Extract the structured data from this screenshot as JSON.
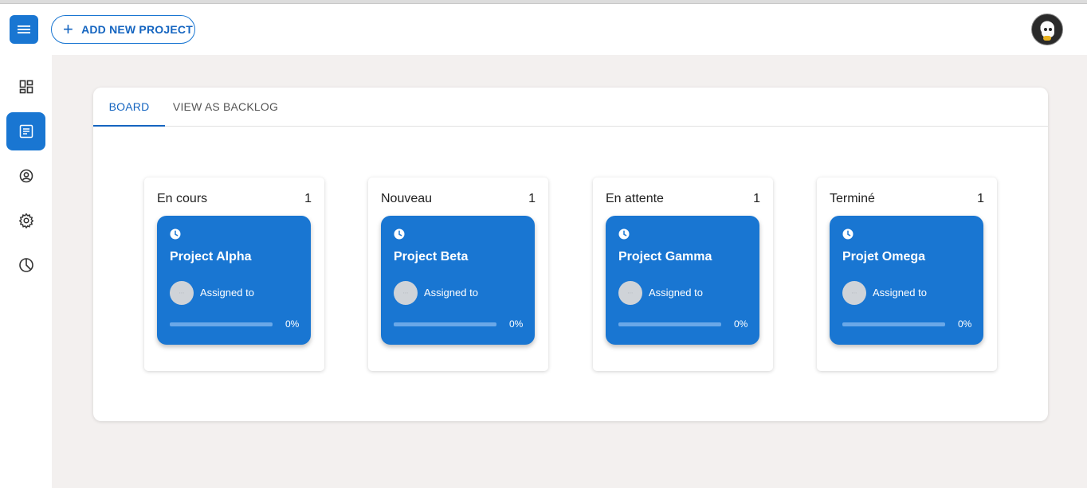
{
  "header": {
    "add_button_label": "ADD NEW PROJECT"
  },
  "sidebar": {
    "items": [
      {
        "icon": "dashboard-icon",
        "active": false
      },
      {
        "icon": "document-list-icon",
        "active": true
      },
      {
        "icon": "user-profile-icon",
        "active": false
      },
      {
        "icon": "gear-icon",
        "active": false
      },
      {
        "icon": "pie-chart-icon",
        "active": false
      }
    ]
  },
  "tabs": [
    {
      "label": "BOARD",
      "active": true
    },
    {
      "label": "VIEW AS BACKLOG",
      "active": false
    }
  ],
  "columns": [
    {
      "title": "En cours",
      "count": "1",
      "cards": [
        {
          "title": "Project Alpha",
          "assigned_label": "Assigned to",
          "progress_label": "0%",
          "progress": 0
        }
      ]
    },
    {
      "title": "Nouveau",
      "count": "1",
      "cards": [
        {
          "title": "Project Beta",
          "assigned_label": "Assigned to",
          "progress_label": "0%",
          "progress": 0
        }
      ]
    },
    {
      "title": "En attente",
      "count": "1",
      "cards": [
        {
          "title": "Project Gamma",
          "assigned_label": "Assigned to",
          "progress_label": "0%",
          "progress": 0
        }
      ]
    },
    {
      "title": "Terminé",
      "count": "1",
      "cards": [
        {
          "title": "Projet Omega",
          "assigned_label": "Assigned to",
          "progress_label": "0%",
          "progress": 0
        }
      ]
    }
  ],
  "colors": {
    "accent": "#1976d2",
    "background": "#f3f0ef"
  }
}
